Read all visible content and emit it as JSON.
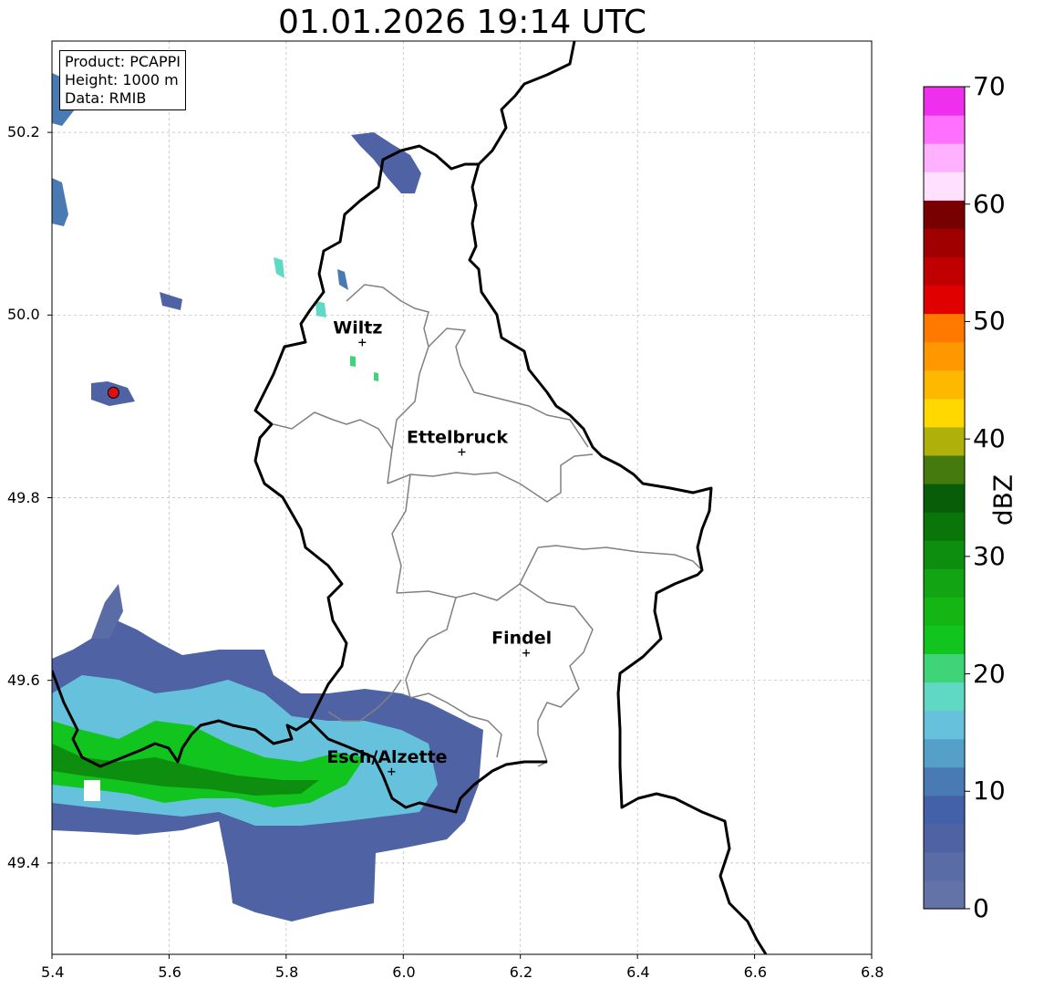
{
  "title": "01.01.2026 19:14 UTC",
  "info": {
    "product": "Product: PCAPPI",
    "height": "Height: 1000 m",
    "data": "Data: RMIB"
  },
  "axes": {
    "x_ticks": [
      "5.4",
      "5.6",
      "5.8",
      "6.0",
      "6.2",
      "6.4",
      "6.6",
      "6.8"
    ],
    "y_ticks": [
      "49.4",
      "49.6",
      "49.8",
      "50.0",
      "50.2"
    ],
    "xlim": [
      5.4,
      6.8
    ],
    "ylim": [
      49.3,
      50.3
    ],
    "grid": true
  },
  "cities": [
    {
      "name": "Wiltz",
      "lon": 5.93,
      "lat": 49.97
    },
    {
      "name": "Ettelbruck",
      "lon": 6.1,
      "lat": 49.85
    },
    {
      "name": "Findel",
      "lon": 6.21,
      "lat": 49.63
    },
    {
      "name": "Esch/Alzette",
      "lon": 5.98,
      "lat": 49.5
    }
  ],
  "radar_site": {
    "lon": 5.505,
    "lat": 49.915,
    "color": "#dd1111"
  },
  "colorbar": {
    "unit": "dBZ",
    "range": [
      0,
      70
    ],
    "labels": [
      "0",
      "10",
      "20",
      "30",
      "40",
      "50",
      "60",
      "70"
    ],
    "colors": [
      "#6373a8",
      "#5a6ca6",
      "#4f63a4",
      "#4361a8",
      "#4a7ab4",
      "#55a0c8",
      "#66c2dc",
      "#5fd9c4",
      "#40d478",
      "#12c51e",
      "#14b614",
      "#12a412",
      "#0e8e0e",
      "#0a760a",
      "#085e08",
      "#447a0e",
      "#b0b00a",
      "#ffd800",
      "#ffb800",
      "#ff9800",
      "#ff7800",
      "#e00000",
      "#c00000",
      "#a00000",
      "#780000",
      "#ffe0ff",
      "#ffb0ff",
      "#ff70ff",
      "#ee30ee"
    ]
  },
  "colors": {
    "border": "#000000",
    "canton": "#808080",
    "grid": "#b8b8b8"
  }
}
